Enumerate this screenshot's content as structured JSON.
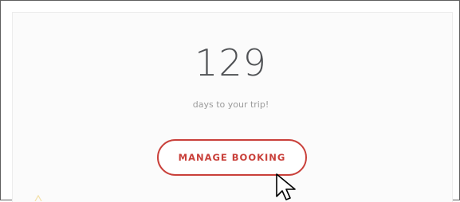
{
  "trip": {
    "days_count": "129",
    "caption": "days to your trip!"
  },
  "actions": {
    "manage_booking_label": "MANAGE BOOKING"
  },
  "colors": {
    "accent": "#c9403a",
    "count_text": "#505255",
    "caption_text": "#9b9b9b"
  },
  "icons": {
    "cursor": "mouse-pointer-icon"
  }
}
